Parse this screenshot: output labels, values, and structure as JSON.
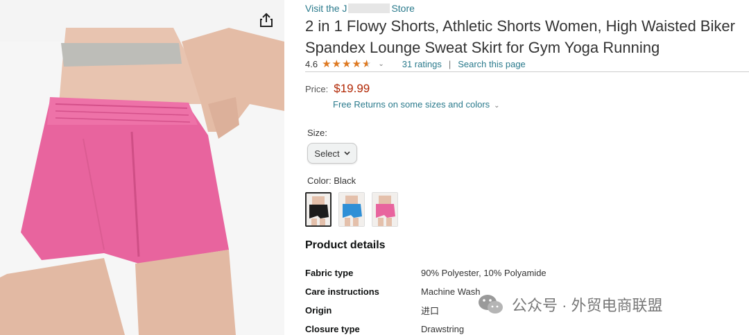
{
  "store": {
    "prefix": "Visit the J",
    "suffix": "Store"
  },
  "product": {
    "title": "2 in 1 Flowy Shorts, Athletic Shorts Women, High Waisted Biker Spandex Lounge Sweat Skirt for Gym Yoga Running",
    "rating_value": "4.6",
    "ratings_count": "31 ratings",
    "search_link": "Search this page"
  },
  "price": {
    "label": "Price:",
    "value": "$19.99",
    "returns": "Free Returns on some sizes and colors"
  },
  "size": {
    "label": "Size:",
    "select_value": "Select"
  },
  "color": {
    "label": "Color: Black",
    "options": [
      "Black",
      "Blue",
      "Pink"
    ]
  },
  "product_details": {
    "heading": "Product details",
    "rows": [
      {
        "key": "Fabric type",
        "value": "90% Polyester, 10% Polyamide"
      },
      {
        "key": "Care instructions",
        "value": "Machine Wash"
      },
      {
        "key": "Origin",
        "value": "进口"
      },
      {
        "key": "Closure type",
        "value": "Drawstring"
      }
    ]
  },
  "watermark": {
    "text": "公众号 · 外贸电商联盟"
  },
  "colors": {
    "link": "#2a7a8c",
    "price": "#b12704",
    "star": "#de7921",
    "shorts": "#e8649e"
  }
}
